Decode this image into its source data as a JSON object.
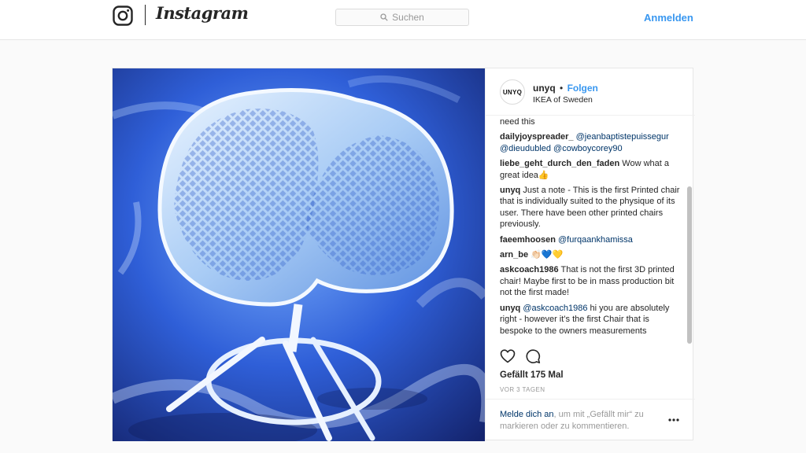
{
  "nav": {
    "wordmark": "Instagram",
    "search_placeholder": "Suchen",
    "login": "Anmelden"
  },
  "post": {
    "avatar_text": "UNYQ",
    "username": "unyq",
    "follow": "Folgen",
    "location": "IKEA of Sweden",
    "comments": [
      {
        "user": "",
        "text": "need this"
      },
      {
        "user": "dailyjoyspreader_",
        "mentions": "@jeanbaptistepuissegur @dieudubled @cowboycorey90",
        "text": ""
      },
      {
        "user": "liebe_geht_durch_den_faden",
        "text": "Wow what a great idea👍"
      },
      {
        "user": "unyq",
        "text": "Just a note - This is the first Printed chair that is individually suited to the physique of its user. There have been other printed chairs previously."
      },
      {
        "user": "faeemhoosen",
        "mentions": "@furqaankhamissa",
        "text": ""
      },
      {
        "user": "arn_be",
        "text": "👏🏻💙💛"
      },
      {
        "user": "askcoach1986",
        "text": "That is not the first 3D printed chair! Maybe first to be in mass production bit not the first made!"
      },
      {
        "user": "unyq",
        "mentions": "@askcoach1986",
        "text": "hi you are absolutely right - however it’s the first Chair that is bespoke to the owners measurements"
      }
    ],
    "likes": "Gefällt 175 Mal",
    "timestamp": "VOR 3 TAGEN",
    "login_prompt": {
      "link": "Melde dich an",
      "rest": ", um mit „Gefällt mir“ zu markieren oder zu kommentieren."
    }
  },
  "icons": {
    "logo": "instagram-camera-icon",
    "search": "search-icon",
    "like": "heart-icon",
    "comment": "comment-bubble-icon",
    "more": "more-dots-icon"
  },
  "colors": {
    "accent": "#3897f0",
    "mention": "#003569",
    "muted": "#999999"
  }
}
